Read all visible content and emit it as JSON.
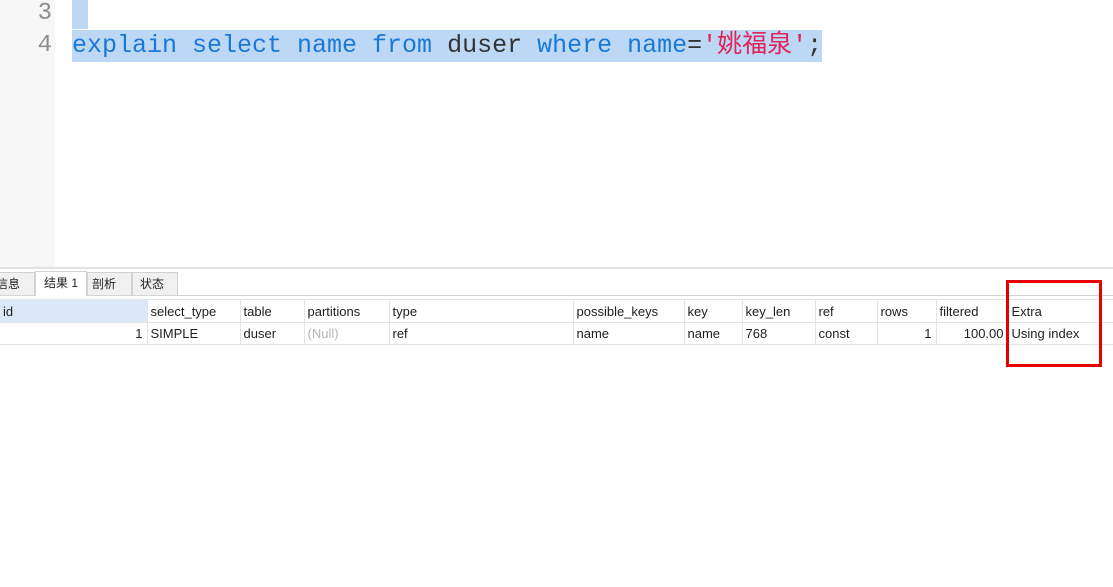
{
  "colors": {
    "selection": "#bcd8f5",
    "selected_header": "#dbe8f7",
    "null_text": "#b4b4b4",
    "annotation": "#e60000",
    "line_number": "#8c8c8c"
  },
  "editor": {
    "lines": [
      {
        "number": "3",
        "tokens": []
      },
      {
        "number": "4",
        "tokens": [
          {
            "text": "explain select name from",
            "color": "#1c78d6"
          },
          {
            "text": " duser ",
            "color": "#333333"
          },
          {
            "text": "where name",
            "color": "#1c78d6"
          },
          {
            "text": "=",
            "color": "#333333"
          },
          {
            "text": "'姚福泉'",
            "color": "#e0245a"
          },
          {
            "text": ";",
            "color": "#333333"
          }
        ]
      }
    ]
  },
  "result_tabs": [
    {
      "label": "信息"
    },
    {
      "label": "结果 1",
      "active": true
    },
    {
      "label": "剖析"
    },
    {
      "label": "状态"
    }
  ],
  "result_grid": {
    "columns": [
      "id",
      "select_type",
      "table",
      "partitions",
      "type",
      "possible_keys",
      "key",
      "key_len",
      "ref",
      "rows",
      "filtered",
      "Extra"
    ],
    "rows": [
      [
        "1",
        "SIMPLE",
        "duser",
        "(Null)",
        "ref",
        "name",
        "name",
        "768",
        "const",
        "1",
        "100.00",
        "Using index"
      ]
    ]
  }
}
